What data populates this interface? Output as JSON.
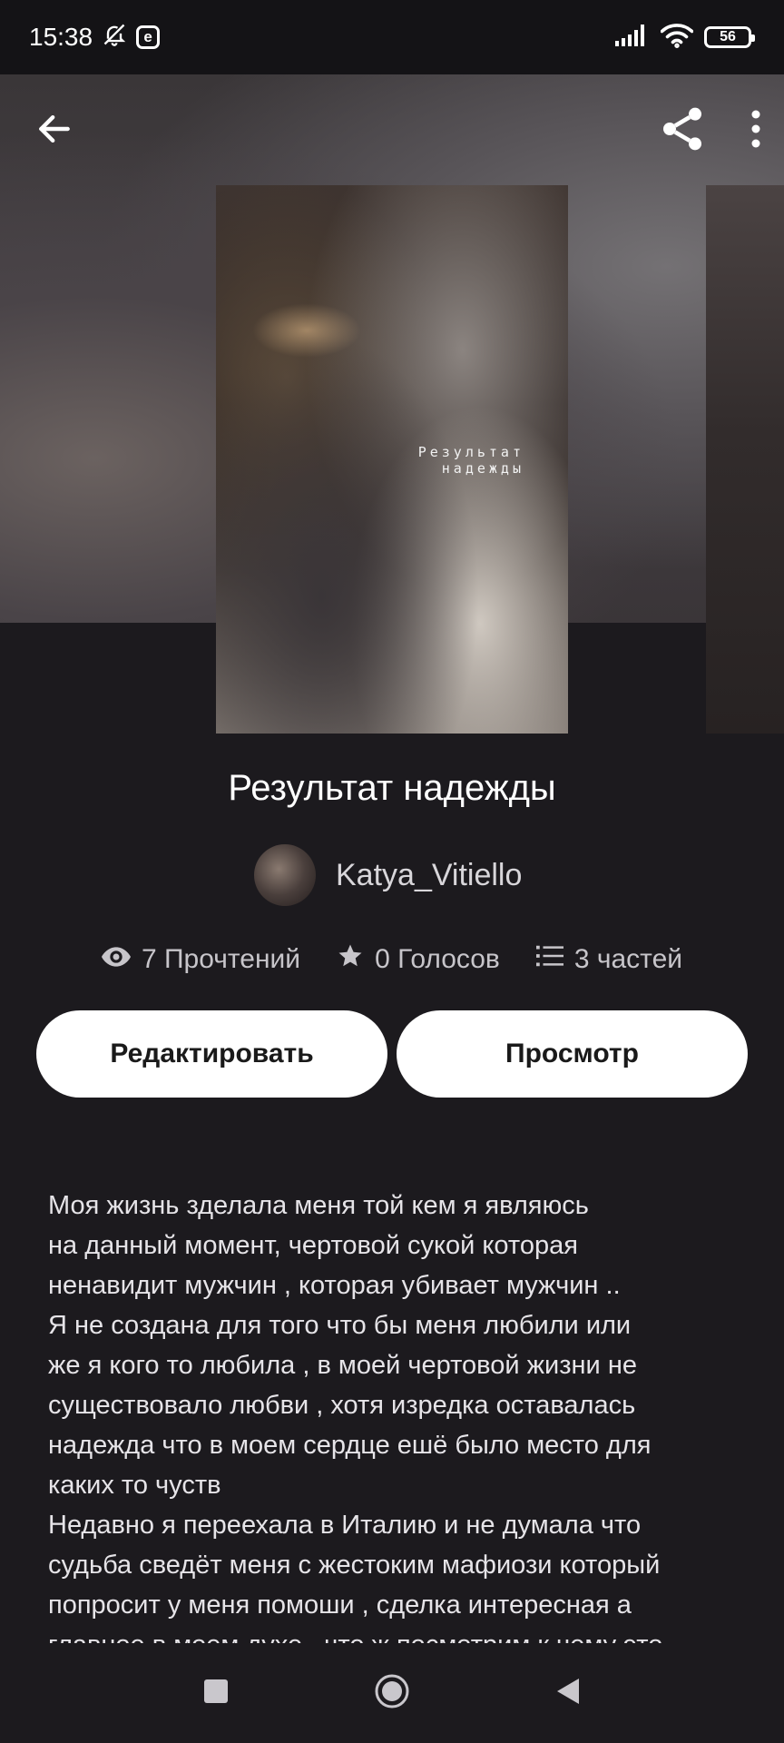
{
  "status_bar": {
    "time": "15:38",
    "e_badge": "e",
    "battery": "56",
    "icons": [
      "bell-off-icon",
      "signal-icon",
      "wifi-icon",
      "battery-icon"
    ]
  },
  "top_bar": {
    "icons": [
      "back-arrow-icon",
      "share-icon",
      "more-vertical-icon"
    ]
  },
  "cover": {
    "text_line1": "Результат",
    "text_line2": "надежды"
  },
  "story": {
    "title": "Результат надежды",
    "author": "Katya_Vitiello",
    "stats": {
      "reads": "7 Прочтений",
      "votes": "0 Голосов",
      "parts": "3 частей"
    },
    "buttons": {
      "edit": "Редактировать",
      "preview": "Просмотр"
    },
    "description": "Моя жизнь зделала меня той кем я являюсь\nна данный момент, чертовой сукой которая\nненавидит мужчин , которая убивает мужчин ..\nЯ не создана для того что бы меня любили или\nже я кого то любила , в моей чертовой жизни не\nсуществовало любви , хотя изредка оставалась\nнадежда что в моем сердце ешё было место для\nкаких то чуств\nНедавно я переехала в Италию и не думала что\nсудьба сведёт меня с жестоким мафиози который\nпопросит у меня помоши , сделка интересная а\nглавное в моем духе , что ж посмотрим к чему это"
  },
  "colors": {
    "background": "#1c1a1e",
    "status_bar": "#141316",
    "button_bg": "#ffffff",
    "button_text": "#1a1a1a",
    "secondary_text": "#c7c5ca"
  },
  "nav_bar": {
    "icons": [
      "recents-square-icon",
      "home-circle-icon",
      "back-triangle-icon"
    ]
  }
}
